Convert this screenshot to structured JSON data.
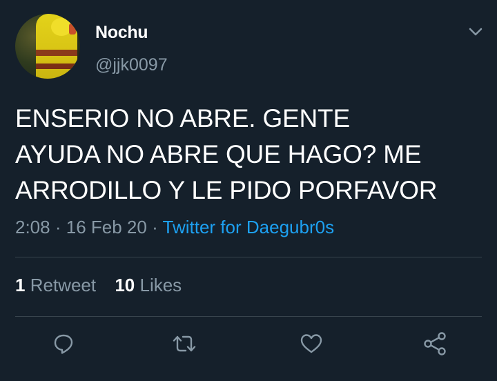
{
  "user": {
    "name": "Nochu",
    "handle": "@jjk0097",
    "avatar_icon": "avatar-yellow-raincoat"
  },
  "tweet": {
    "lines": [
      "ENSERIO NO ABRE. GENTE",
      "AYUDA NO ABRE QUE HAGO? ME",
      "ARRODILLO Y LE PIDO PORFAVOR"
    ],
    "time": "2:08",
    "date": "16 Feb 20",
    "separator": "·",
    "source": "Twitter for Daegubr0s"
  },
  "stats": {
    "retweets_count": "1",
    "retweets_label": "Retweet",
    "likes_count": "10",
    "likes_label": "Likes"
  },
  "actions": [
    {
      "name": "reply",
      "icon": "comment-icon"
    },
    {
      "name": "retweet",
      "icon": "retweet-icon"
    },
    {
      "name": "like",
      "icon": "heart-icon"
    },
    {
      "name": "share",
      "icon": "share-icon"
    }
  ],
  "colors": {
    "background": "#15202b",
    "text": "#ffffff",
    "secondary_text": "#8899a6",
    "link": "#1da1f2",
    "divider": "#38444d"
  }
}
